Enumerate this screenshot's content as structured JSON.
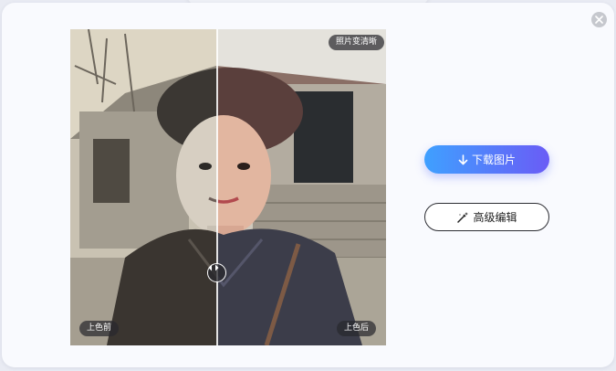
{
  "modal": {
    "close_icon": "close-icon"
  },
  "preview": {
    "top_badge": "照片变清晰",
    "before_label": "上色前",
    "after_label": "上色后",
    "handle_icon": "compare-arrows-icon"
  },
  "actions": {
    "download_label": "下载图片",
    "download_icon": "download-arrow-icon",
    "edit_label": "高级编辑",
    "edit_icon": "magic-wand-icon",
    "download_gradient": [
      "#3fa0ff",
      "#6a5cf6"
    ]
  }
}
